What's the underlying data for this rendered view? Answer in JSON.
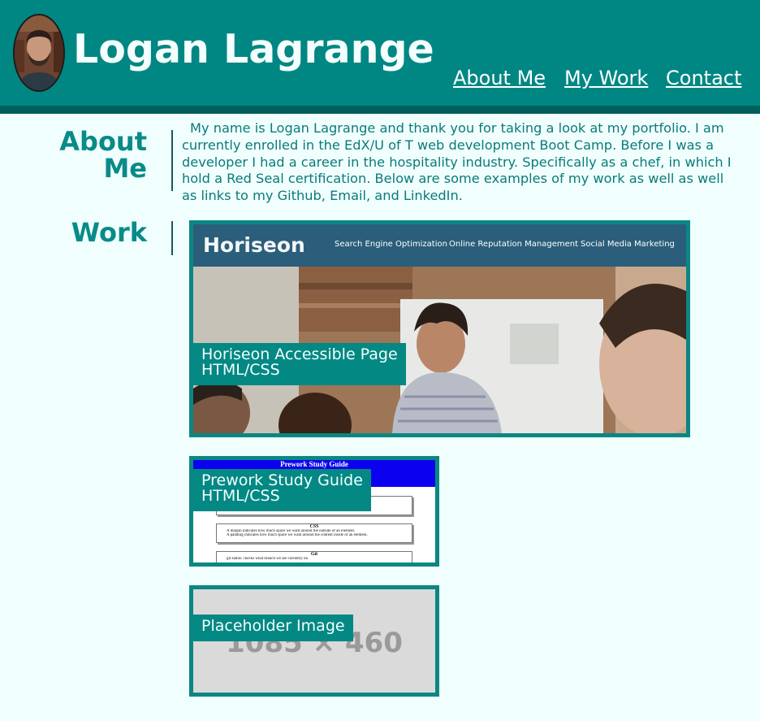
{
  "header": {
    "name": "Logan Lagrange",
    "nav": [
      {
        "label": "About Me"
      },
      {
        "label": "My Work"
      },
      {
        "label": "Contact"
      }
    ]
  },
  "about": {
    "title_line1": "About",
    "title_line2": "Me",
    "text": "My name is Logan Lagrange and thank you for taking a look at my portfolio. I am currently enrolled in the EdX/U of T web development Boot Camp. Before I was a developer I had a career in the hospitality industry. Specifically as a chef, in which I hold a Red Seal certification. Below are some examples of my work as well as well as links to my Github, Email, and LinkedIn."
  },
  "work": {
    "title": "Work",
    "projects": [
      {
        "label_line1": "Horiseon Accessible Page",
        "label_line2": "HTML/CSS",
        "preview": {
          "brand": "Horiseon",
          "nav": [
            "Search Engine Optimization",
            "Online Reputation Management",
            "Social Media Marketing"
          ]
        }
      },
      {
        "label_line1": "Prework Study Guide",
        "label_line2": "HTML/CSS",
        "preview": {
          "heading": "Prework Study Guide",
          "section1": "CSS",
          "bullets1": [
            "A margin indicates how much space we want around the outside of an element.",
            "A padding indicates how much space we want around the content inside of an element."
          ],
          "section2": "Git",
          "bullets2": [
            "git status: checks what branch we are currently on"
          ]
        }
      },
      {
        "label_line1": "Placeholder Image",
        "preview": {
          "placeholder_text": "1085 × 460"
        }
      }
    ]
  },
  "colors": {
    "header_bg": "#008783",
    "header_border": "#005f5c",
    "page_bg": "#f0fffe",
    "accent": "#088b88"
  }
}
